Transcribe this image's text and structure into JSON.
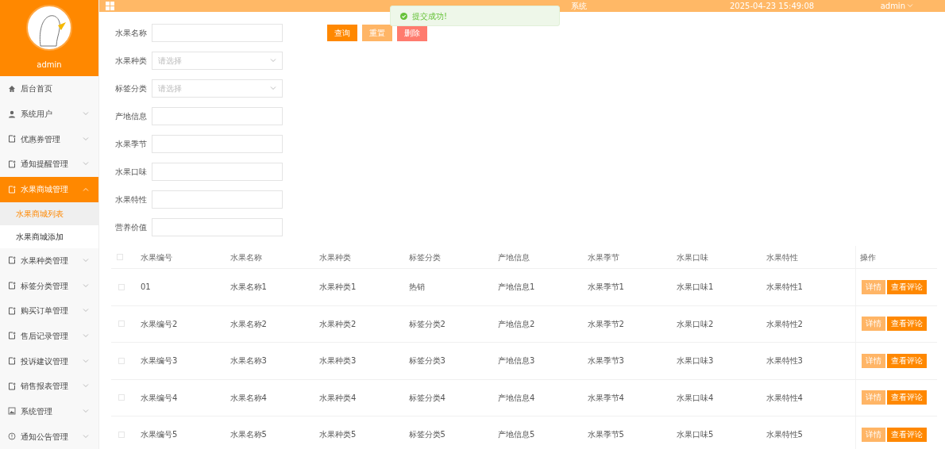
{
  "header": {
    "title_fragment": "系统",
    "datetime": "2025-04-23 15:49:08",
    "user": "admin"
  },
  "toast": {
    "message": "提交成功!"
  },
  "profile": {
    "name": "admin"
  },
  "sidebar": {
    "items": [
      {
        "label": "后台首页",
        "kind": "home",
        "selected": false
      },
      {
        "label": "系统用户",
        "kind": "user",
        "expanded": false,
        "selected": false
      },
      {
        "label": "优惠券管理",
        "kind": "doc",
        "expanded": false,
        "selected": false
      },
      {
        "label": "通知提醒管理",
        "kind": "doc",
        "expanded": false,
        "selected": false
      },
      {
        "label": "水果商城管理",
        "kind": "doc",
        "expanded": true,
        "selected": true,
        "children": [
          {
            "label": "水果商城列表",
            "selected": true
          },
          {
            "label": "水果商城添加",
            "selected": false
          }
        ]
      },
      {
        "label": "水果种类管理",
        "kind": "doc",
        "expanded": false,
        "selected": false
      },
      {
        "label": "标签分类管理",
        "kind": "doc",
        "expanded": false,
        "selected": false
      },
      {
        "label": "购买订单管理",
        "kind": "doc",
        "expanded": false,
        "selected": false
      },
      {
        "label": "售后记录管理",
        "kind": "doc",
        "expanded": false,
        "selected": false
      },
      {
        "label": "投诉建议管理",
        "kind": "doc",
        "expanded": false,
        "selected": false
      },
      {
        "label": "销售报表管理",
        "kind": "doc",
        "expanded": false,
        "selected": false
      },
      {
        "label": "系统管理",
        "kind": "image",
        "expanded": false,
        "selected": false
      },
      {
        "label": "通知公告管理",
        "kind": "info",
        "expanded": false,
        "selected": false
      }
    ]
  },
  "filters": [
    {
      "label": "水果名称",
      "kind": "input"
    },
    {
      "label": "水果种类",
      "kind": "select",
      "placeholder": "请选择"
    },
    {
      "label": "标签分类",
      "kind": "select",
      "placeholder": "请选择"
    },
    {
      "label": "产地信息",
      "kind": "input"
    },
    {
      "label": "水果季节",
      "kind": "input"
    },
    {
      "label": "水果口味",
      "kind": "input"
    },
    {
      "label": "水果特性",
      "kind": "input"
    },
    {
      "label": "营养价值",
      "kind": "input"
    }
  ],
  "actions": [
    {
      "label": "查询",
      "kind": "primary"
    },
    {
      "label": "重置",
      "kind": "light"
    },
    {
      "label": "删除",
      "kind": "danger"
    }
  ],
  "table": {
    "columns": [
      "水果编号",
      "水果名称",
      "水果种类",
      "标签分类",
      "产地信息",
      "水果季节",
      "水果口味",
      "水果特性",
      "操作"
    ],
    "all_checked": false,
    "rows": [
      {
        "checked": false,
        "cells": [
          "01",
          "水果名称1",
          "水果种类1",
          "热销",
          "产地信息1",
          "水果季节1",
          "水果口味1",
          "水果特性1"
        ],
        "buttons": [
          "详情",
          "查看评论"
        ]
      },
      {
        "checked": false,
        "cells": [
          "水果编号2",
          "水果名称2",
          "水果种类2",
          "标签分类2",
          "产地信息2",
          "水果季节2",
          "水果口味2",
          "水果特性2"
        ],
        "buttons": [
          "详情",
          "查看评论"
        ]
      },
      {
        "checked": false,
        "cells": [
          "水果编号3",
          "水果名称3",
          "水果种类3",
          "标签分类3",
          "产地信息3",
          "水果季节3",
          "水果口味3",
          "水果特性3"
        ],
        "buttons": [
          "详情",
          "查看评论"
        ]
      },
      {
        "checked": false,
        "cells": [
          "水果编号4",
          "水果名称4",
          "水果种类4",
          "标签分类4",
          "产地信息4",
          "水果季节4",
          "水果口味4",
          "水果特性4"
        ],
        "buttons": [
          "详情",
          "查看评论"
        ]
      },
      {
        "checked": false,
        "cells": [
          "水果编号5",
          "水果名称5",
          "水果种类5",
          "标签分类5",
          "产地信息5",
          "水果季节5",
          "水果口味5",
          "水果特性5"
        ],
        "buttons": [
          "详情",
          "查看评论"
        ]
      }
    ]
  }
}
